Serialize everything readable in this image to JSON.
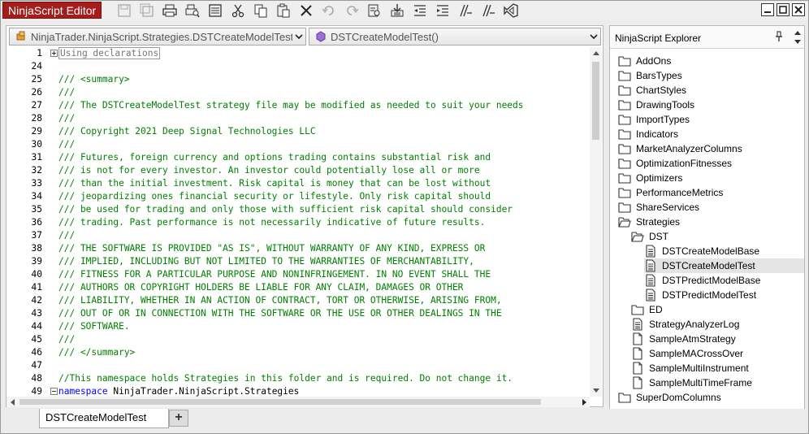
{
  "window": {
    "title": "NinjaScript Editor"
  },
  "toolbar": {
    "icons": [
      "save-icon",
      "save-all-icon",
      "print-icon",
      "print-preview-icon",
      "properties-icon",
      "cut-icon",
      "copy-icon",
      "paste-icon",
      "delete-icon",
      "undo-icon",
      "redo-icon",
      "find-icon",
      "import-icon",
      "outdent-icon",
      "indent-icon",
      "comment-icon",
      "uncomment-icon",
      "visual-studio-icon"
    ]
  },
  "editor": {
    "class_combo": "NinjaTrader.NinjaScript.Strategies.DSTCreateModelTest",
    "member_combo": "DSTCreateModelTest()",
    "lines": [
      {
        "n": "1",
        "fold": "plus",
        "text": "Using declarations",
        "style": "collapsed"
      },
      {
        "n": "24",
        "text": ""
      },
      {
        "n": "25",
        "text": "/// <summary>"
      },
      {
        "n": "26",
        "text": "///"
      },
      {
        "n": "27",
        "text": "/// The DSTCreateModelTest strategy file may be modified as needed to suit your needs"
      },
      {
        "n": "28",
        "text": "///"
      },
      {
        "n": "29",
        "text": "/// Copyright 2021 Deep Signal Technologies LLC"
      },
      {
        "n": "30",
        "text": "///"
      },
      {
        "n": "31",
        "text": "/// Futures, foreign currency and options trading contains substantial risk and"
      },
      {
        "n": "32",
        "text": "/// is not for every investor. An investor could potentially lose all or more"
      },
      {
        "n": "33",
        "text": "/// than the initial investment. Risk capital is money that can be lost without"
      },
      {
        "n": "34",
        "text": "/// jeopardizing ones financial security or lifestyle. Only risk capital should"
      },
      {
        "n": "35",
        "text": "/// be used for trading and only those with sufficient risk capital should consider"
      },
      {
        "n": "36",
        "text": "/// trading. Past performance is not necessarily indicative of future results."
      },
      {
        "n": "37",
        "text": "///"
      },
      {
        "n": "38",
        "text": "/// THE SOFTWARE IS PROVIDED \"AS IS\", WITHOUT WARRANTY OF ANY KIND, EXPRESS OR"
      },
      {
        "n": "39",
        "text": "/// IMPLIED, INCLUDING BUT NOT LIMITED TO THE WARRANTIES OF MERCHANTABILITY,"
      },
      {
        "n": "40",
        "text": "/// FITNESS FOR A PARTICULAR PURPOSE AND NONINFRINGEMENT. IN NO EVENT SHALL THE"
      },
      {
        "n": "41",
        "text": "/// AUTHORS OR COPYRIGHT HOLDERS BE LIABLE FOR ANY CLAIM, DAMAGES OR OTHER"
      },
      {
        "n": "42",
        "text": "/// LIABILITY, WHETHER IN AN ACTION OF CONTRACT, TORT OR OTHERWISE, ARISING FROM,"
      },
      {
        "n": "43",
        "text": "/// OUT OF OR IN CONNECTION WITH THE SOFTWARE OR THE USE OR OTHER DEALINGS IN THE"
      },
      {
        "n": "44",
        "text": "/// SOFTWARE."
      },
      {
        "n": "45",
        "text": "///"
      },
      {
        "n": "46",
        "text": "/// </summary>"
      },
      {
        "n": "47",
        "text": ""
      },
      {
        "n": "48",
        "text": "//This namespace holds Strategies in this folder and is required. Do not change it."
      },
      {
        "n": "49",
        "fold": "minus",
        "keyword": "namespace",
        "text": " NinjaTrader.NinjaScript.Strategies",
        "style": "plain"
      }
    ]
  },
  "explorer": {
    "title": "NinjaScript Explorer",
    "items": [
      {
        "label": "AddOns",
        "type": "folder",
        "level": 0
      },
      {
        "label": "BarsTypes",
        "type": "folder",
        "level": 0
      },
      {
        "label": "ChartStyles",
        "type": "folder",
        "level": 0
      },
      {
        "label": "DrawingTools",
        "type": "folder",
        "level": 0
      },
      {
        "label": "ImportTypes",
        "type": "folder",
        "level": 0
      },
      {
        "label": "Indicators",
        "type": "folder",
        "level": 0
      },
      {
        "label": "MarketAnalyzerColumns",
        "type": "folder",
        "level": 0
      },
      {
        "label": "OptimizationFitnesses",
        "type": "folder",
        "level": 0
      },
      {
        "label": "Optimizers",
        "type": "folder",
        "level": 0
      },
      {
        "label": "PerformanceMetrics",
        "type": "folder",
        "level": 0
      },
      {
        "label": "ShareServices",
        "type": "folder",
        "level": 0
      },
      {
        "label": "Strategies",
        "type": "folder-open",
        "level": 0
      },
      {
        "label": "DST",
        "type": "folder-open",
        "level": 1
      },
      {
        "label": "DSTCreateModelBase",
        "type": "file-text",
        "level": 2
      },
      {
        "label": "DSTCreateModelTest",
        "type": "file-text",
        "level": 2,
        "selected": true
      },
      {
        "label": "DSTPredictModelBase",
        "type": "file-text",
        "level": 2
      },
      {
        "label": "DSTPredictModelTest",
        "type": "file-text",
        "level": 2
      },
      {
        "label": "ED",
        "type": "folder",
        "level": 1
      },
      {
        "label": "StrategyAnalyzerLog",
        "type": "file-text",
        "level": 1
      },
      {
        "label": "SampleAtmStrategy",
        "type": "file",
        "level": 1
      },
      {
        "label": "SampleMACrossOver",
        "type": "file",
        "level": 1
      },
      {
        "label": "SampleMultiInstrument",
        "type": "file",
        "level": 1
      },
      {
        "label": "SampleMultiTimeFrame",
        "type": "file",
        "level": 1
      },
      {
        "label": "SuperDomColumns",
        "type": "folder",
        "level": 0
      }
    ]
  },
  "tabs": {
    "active": "DSTCreateModelTest",
    "add_label": "+"
  }
}
